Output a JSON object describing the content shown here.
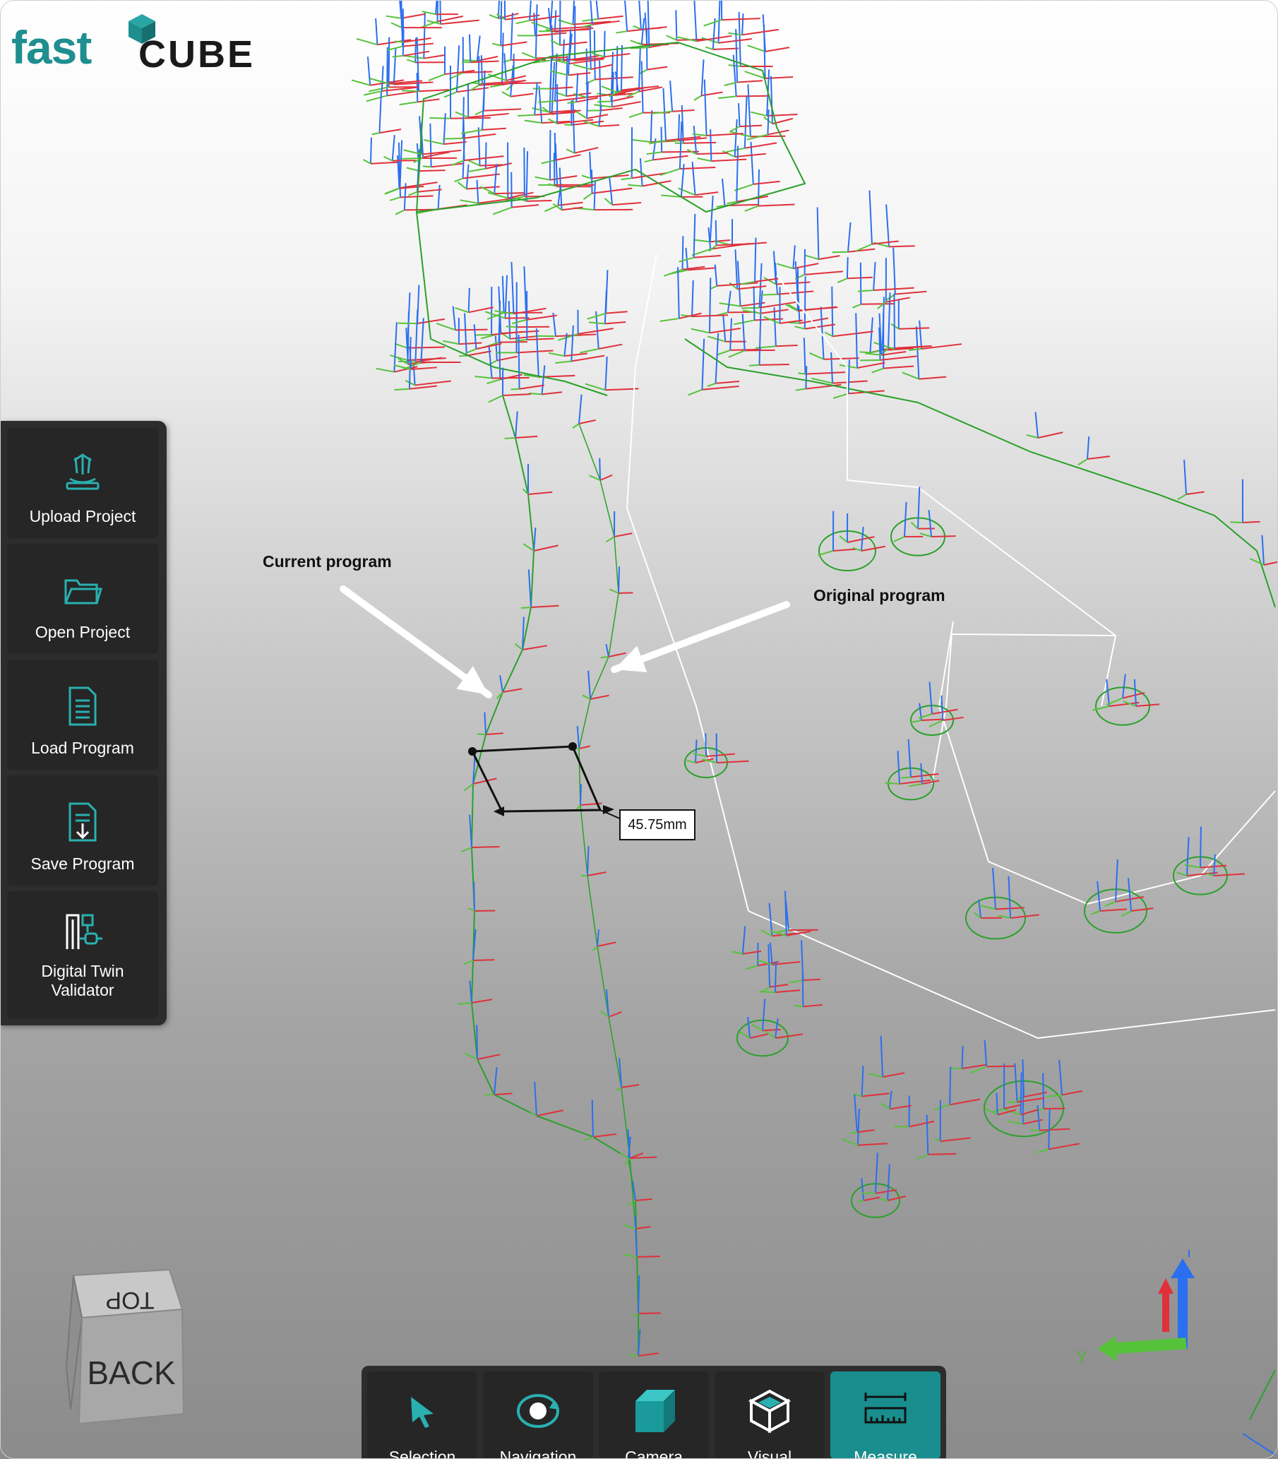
{
  "app": {
    "logo_fast": "fast",
    "logo_cube": "CUBE",
    "brand_color": "#1e8e8e"
  },
  "sidebar": {
    "items": [
      {
        "label": "Upload Project",
        "icon": "upload-project-icon"
      },
      {
        "label": "Open Project",
        "icon": "folder-icon"
      },
      {
        "label": "Load Program",
        "icon": "document-icon"
      },
      {
        "label": "Save Program",
        "icon": "save-document-icon"
      },
      {
        "label": "Digital Twin Validator",
        "icon": "digital-twin-icon"
      }
    ]
  },
  "annotations": {
    "current": "Current program",
    "original": "Original program",
    "measurement": "45.75mm"
  },
  "navcube": {
    "top_face": "TOP",
    "front_face": "BACK"
  },
  "axes": {
    "y_label": "Y",
    "colors": {
      "x": "#e0303a",
      "y": "#56c23a",
      "z": "#2a6ff0"
    }
  },
  "toolbar": {
    "items": [
      {
        "label": "Selection",
        "icon": "cursor-icon",
        "active": false
      },
      {
        "label": "Navigation",
        "icon": "orbit-icon",
        "active": false
      },
      {
        "label": "Camera",
        "icon": "cube-icon",
        "active": false
      },
      {
        "label": "Visual",
        "icon": "wireframe-cube-icon",
        "active": false
      },
      {
        "label": "Measure",
        "icon": "ruler-icon",
        "active": true
      }
    ]
  }
}
